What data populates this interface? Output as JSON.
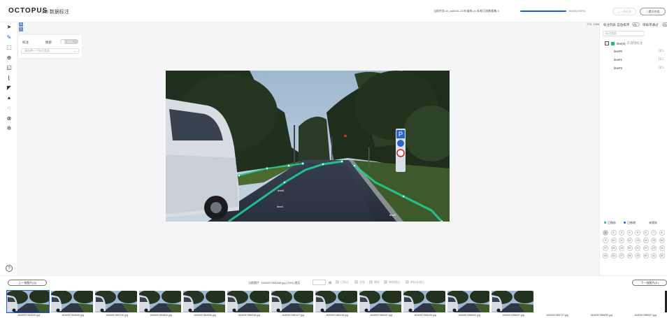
{
  "header": {
    "logo": "OCTOPUS",
    "title": "2D 数据标注",
    "task_label": "当前任务:ch_ad0001-2D车道线-ch-标框可选数据集-0",
    "progress": {
      "fraction": 1.0,
      "text": "50/50(100%)"
    },
    "prev_task_label": "上一条任务",
    "submit_label": "△提交任务"
  },
  "toolbar": {
    "tools": [
      "select-arrow-icon",
      "pen-icon",
      "box-select-icon",
      "point-icon",
      "rect-tool-icon",
      "polyline-icon",
      "brush-icon",
      "pin-icon",
      "lasso-icon",
      "magic-select-icon",
      "smart-tool-icon"
    ],
    "active_tool": "pen-icon"
  },
  "canvas": {
    "coord": "-779, 1386",
    "zoom_in": "+",
    "zoom_out": "−"
  },
  "label_panel": {
    "title": "标注",
    "search_label": "搜索",
    "toggle_text": "关闭",
    "select_placeholder": "请选择一个标注类别"
  },
  "annotations": [
    {
      "name": "line#0",
      "color": "#18c27d"
    },
    {
      "name": "line#1",
      "color": "#18c27d"
    },
    {
      "name": "line#2",
      "color": "#18c27d"
    }
  ],
  "right_panel": {
    "heading": "标注列表",
    "auto_order_label": "自动排序",
    "show_all_label": "审核单通过",
    "search_placeholder": "标注搜索",
    "group_name": "line(3)",
    "group_sub": "车道线标注",
    "items": [
      "line#0",
      "line#1",
      "line#2"
    ]
  },
  "legend": {
    "done": "已保存",
    "done_color": "#18c27d",
    "modified": "已修改",
    "modified_color": "#1f5fe0",
    "undone": "未保存"
  },
  "pages": [
    1,
    2,
    3,
    4,
    5,
    6,
    7,
    8,
    9,
    10,
    11,
    12,
    13,
    14,
    15,
    16,
    17,
    18,
    19,
    20,
    21,
    22,
    23,
    24,
    25,
    26,
    27,
    28,
    29,
    30,
    31,
    32
  ],
  "current_page": 1,
  "bottom": {
    "prev_image": "上一张图片(Q)",
    "next_image": "下一张图片(E)",
    "current_info": "当前图片: 1630057384535.jpg (1/50)   跳至",
    "frame_unit": "帧",
    "flags": [
      "已标注",
      "无效",
      "跳帧",
      "审核通过",
      "审核未通过"
    ]
  },
  "thumbnails": [
    "1630057384535.jpg",
    "1630057384635.jpg",
    "1630057384730.jpg",
    "1630057384830.jpg",
    "1630057384936.jpg",
    "1630057385036.jpg",
    "1630057385137.jpg",
    "1630057385236.jpg",
    "1630057385337.jpg",
    "1630057385438.jpg",
    "1630057385530.jpg",
    "1630057385637.jpg",
    "1630057385727.jpg",
    "1630057385839.jpg",
    "1630057385937.jpg"
  ],
  "thumbnails_loaded": 12
}
